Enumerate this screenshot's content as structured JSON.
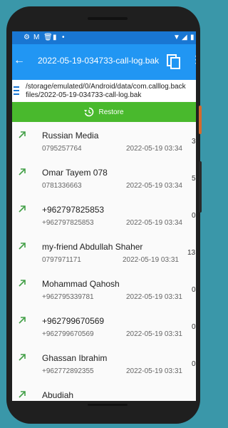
{
  "app": {
    "title": "2022-05-19-034733-call-log.bak",
    "back_icon": "back-arrow-icon",
    "copy_icon": "copy-icon",
    "overflow_icon": "more-vert-icon"
  },
  "status_bar": {
    "icons": [
      "gear-icon",
      "gmail-icon",
      "trash-icon",
      "sd-card-icon",
      "dot-icon",
      "wifi-icon",
      "signal-icon",
      "battery-icon"
    ]
  },
  "path": {
    "line1": "/storage/emulated/0/Android/data/com.calllog.back",
    "line2": "files/2022-05-19-034733-call-log.bak"
  },
  "restore": {
    "label": "Restore",
    "icon": "restore-history-icon"
  },
  "calls": [
    {
      "name": "Russian Media",
      "number": "0795257764",
      "date": "2022-05-19 03:34",
      "duration": "3"
    },
    {
      "name": "Omar Tayem 078",
      "number": "0781336663",
      "date": "2022-05-19 03:34",
      "duration": "5"
    },
    {
      "name": "+962797825853",
      "number": "+962797825853",
      "date": "2022-05-19 03:34",
      "duration": "0"
    },
    {
      "name": "my-friend Abdullah Shaher",
      "number": "0797971171",
      "date": "2022-05-19 03:31",
      "duration": "13"
    },
    {
      "name": "Mohammad Qahosh",
      "number": "+962795339781",
      "date": "2022-05-19 03:31",
      "duration": "0"
    },
    {
      "name": "+962799670569",
      "number": "+962799670569",
      "date": "2022-05-19 03:31",
      "duration": "0"
    },
    {
      "name": "Ghassan Ibrahim",
      "number": "+962772892355",
      "date": "2022-05-19 03:31",
      "duration": "0"
    },
    {
      "name": "Abudiah",
      "number": "",
      "date": "",
      "duration": ""
    }
  ],
  "colors": {
    "status_bar": "#1976d2",
    "app_bar": "#2196f3",
    "restore": "#49b92d",
    "outgoing_arrow": "#43a047"
  }
}
